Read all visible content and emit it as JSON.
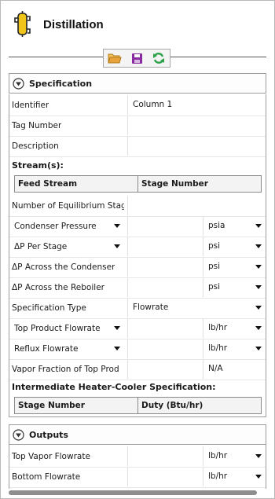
{
  "header": {
    "title": "Distillation",
    "icon": "distillation-column-icon"
  },
  "toolbar": {
    "buttons": [
      "open-folder-icon",
      "save-icon",
      "refresh-icon"
    ]
  },
  "specification": {
    "label": "Specification",
    "rows": {
      "identifier": {
        "label": "Identifier",
        "value": "Column 1"
      },
      "tag_number": {
        "label": "Tag Number",
        "value": ""
      },
      "description": {
        "label": "Description",
        "value": ""
      }
    },
    "streams_label": "Stream(s):",
    "streams_columns": [
      "Feed Stream",
      "Stage Number"
    ],
    "num_stages": {
      "label": "Number of Equilibrium Stag",
      "value": ""
    },
    "condenser_pressure": {
      "label": "Condenser Pressure",
      "value": "",
      "unit": "psia"
    },
    "dp_per_stage": {
      "label": "ΔP Per Stage",
      "value": "",
      "unit": "psi"
    },
    "dp_condenser": {
      "label": "ΔP Across the Condenser",
      "value": "",
      "unit": "psi"
    },
    "dp_reboiler": {
      "label": "ΔP Across the Reboiler",
      "value": "",
      "unit": "psi"
    },
    "spec_type": {
      "label": "Specification Type",
      "value": "Flowrate"
    },
    "top_product_flowrate": {
      "label": "Top Product Flowrate",
      "value": "",
      "unit": "lb/hr"
    },
    "reflux_flowrate": {
      "label": "Reflux Flowrate",
      "value": "",
      "unit": "lb/hr"
    },
    "vapor_fraction": {
      "label": "Vapor Fraction of Top Prod",
      "value": "N/A"
    },
    "heater_cooler_label": "Intermediate Heater-Cooler Specification:",
    "heater_cooler_columns": [
      "Stage Number",
      "Duty (Btu/hr)"
    ]
  },
  "outputs": {
    "label": "Outputs",
    "top_vapor_flowrate": {
      "label": "Top Vapor Flowrate",
      "value": "",
      "unit": "lb/hr"
    },
    "bottom_flowrate": {
      "label": "Bottom Flowrate",
      "value": "",
      "unit": "lb/hr"
    }
  },
  "colors": {
    "folder": "#e8a23a",
    "save": "#8a2aa0",
    "refresh": "#2ea24a",
    "column_yellow": "#f0c419"
  }
}
